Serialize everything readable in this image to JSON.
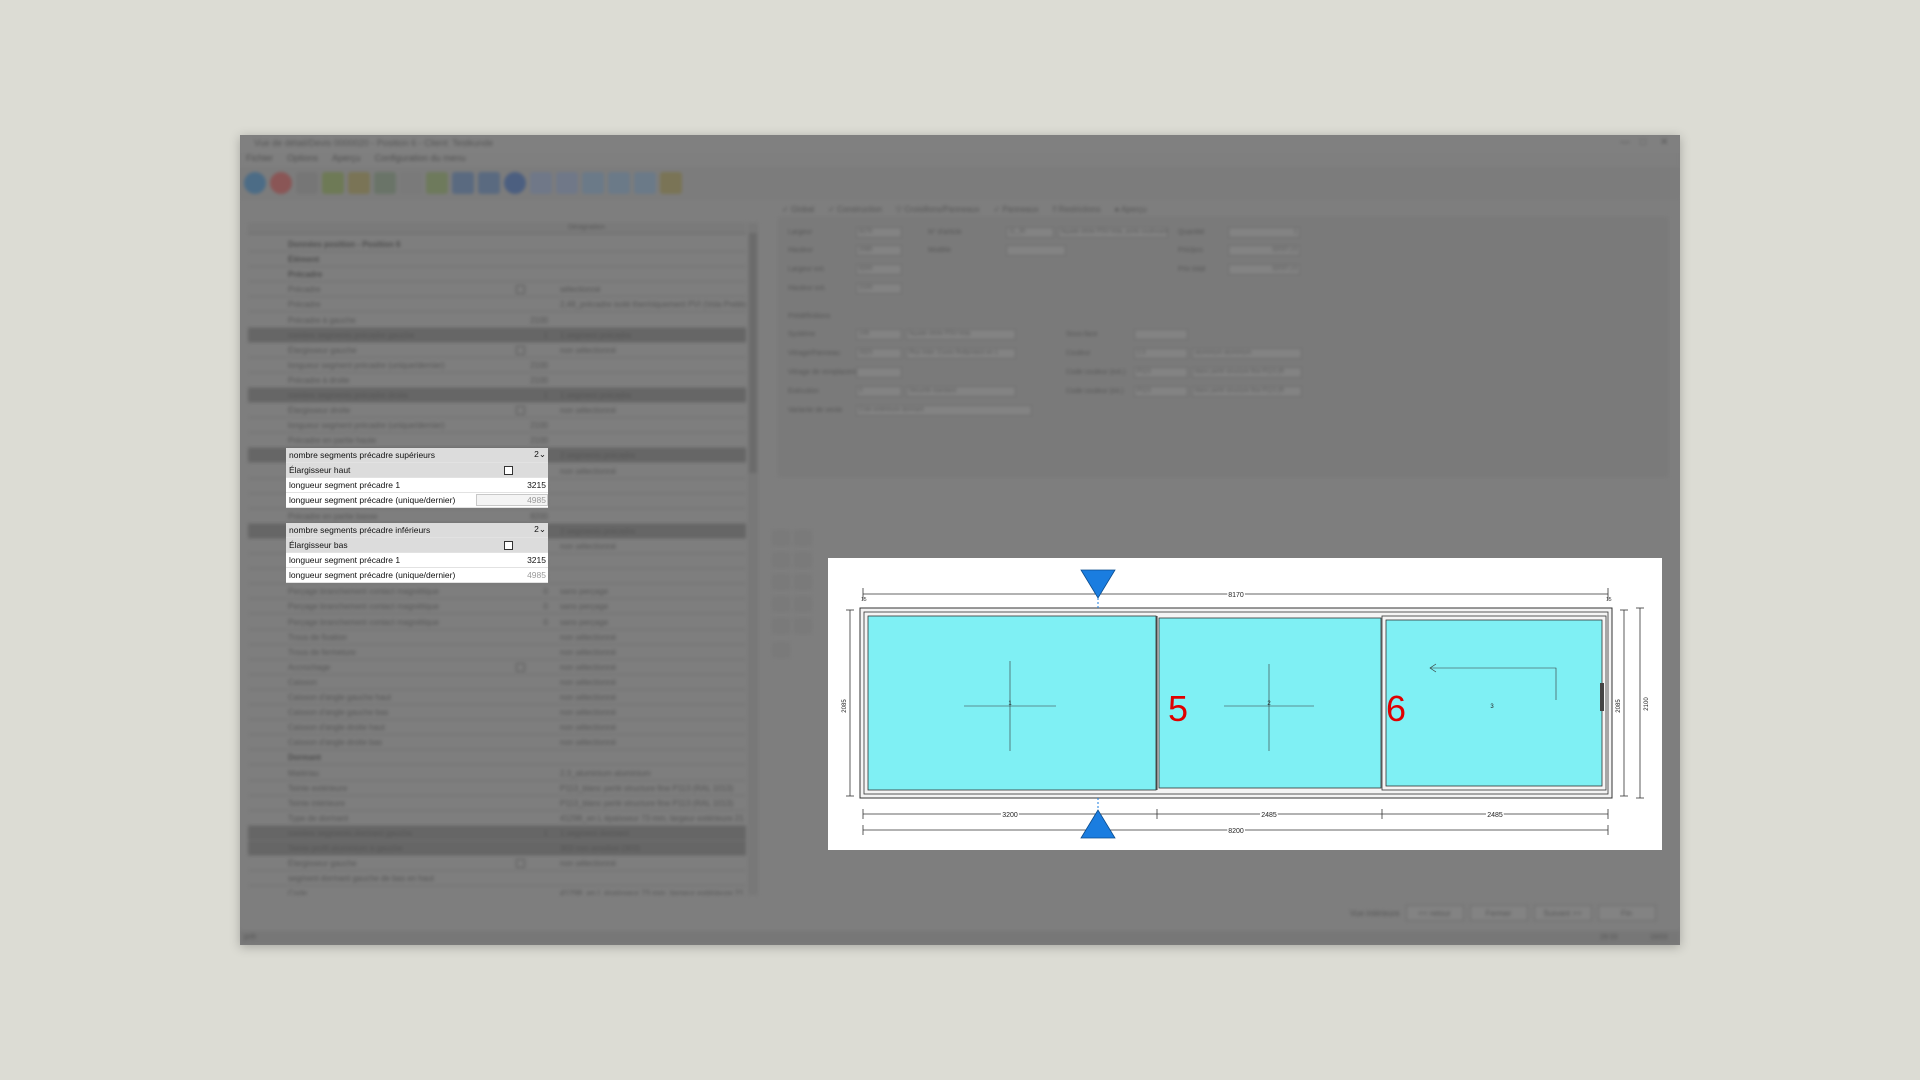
{
  "window": {
    "title": "Vue de détail/Devis 0000020 - Position 6 - Client: Testkunde",
    "menu": [
      "Fichier",
      "Options",
      "Aperçu",
      "Configuration du menu"
    ]
  },
  "grid": {
    "header": {
      "designation": "Désignation"
    },
    "rows": [
      {
        "label": "Données position - Position 6",
        "type": "sect"
      },
      {
        "label": "Élément",
        "type": "sect"
      },
      {
        "label": "Précadre",
        "type": "sect"
      },
      {
        "label": "Précadre",
        "value": "",
        "desc": "sélectionné",
        "check": true
      },
      {
        "label": "Précadre",
        "value": "",
        "desc": "2,48_précadre isolé thermiquement PVI (Vola Preblo)"
      },
      {
        "label": "Précadre à gauche",
        "value": "2100",
        "desc": ""
      },
      {
        "label": "nombre segments précadre gauche",
        "value": "1",
        "desc": "1 segment précadre",
        "type": "dark"
      },
      {
        "label": "Élargisseur gauche",
        "value": "",
        "desc": "non sélectionné",
        "check": true
      },
      {
        "label": "longueur segment précadre (unique/dernier)",
        "value": "2100",
        "desc": ""
      },
      {
        "label": "Précadre à droite",
        "value": "2100",
        "desc": ""
      },
      {
        "label": "nombre segments précadre droite",
        "value": "1",
        "desc": "1 segment précadre",
        "type": "dark"
      },
      {
        "label": "Élargisseur droite",
        "value": "",
        "desc": "non sélectionné",
        "check": true
      },
      {
        "label": "longueur segment précadre (unique/dernier)",
        "value": "2100",
        "desc": ""
      },
      {
        "label": "Précadre en partie haute",
        "value": "2100",
        "desc": ""
      },
      {
        "label": "nombre segments précadre supérieurs",
        "value": "2",
        "desc": "2 segments précadre",
        "type": "dark"
      },
      {
        "label": "Élargisseur haut",
        "value": "",
        "desc": "non sélectionné"
      },
      {
        "label": "longueur segment précadre 1",
        "value": "3215",
        "desc": ""
      },
      {
        "label": "longueur segment précadre (unique/dernier)",
        "value": "4985",
        "desc": ""
      },
      {
        "label": "Précadre en partie basse",
        "value": "8200",
        "desc": ""
      },
      {
        "label": "nombre segments précadre inférieurs",
        "value": "2",
        "desc": "2 segments précadre",
        "type": "dark"
      },
      {
        "label": "Élargisseur bas",
        "value": "",
        "desc": "non sélectionné"
      },
      {
        "label": "longueur segment précadre 1",
        "value": "3215",
        "desc": ""
      },
      {
        "label": "longueur segment précadre (unique/dernier)",
        "value": "4985",
        "desc": ""
      },
      {
        "label": "Perçage branchement contact magnétique",
        "value": "0",
        "desc": "sans perçage"
      },
      {
        "label": "Perçage branchement contact magnétique",
        "value": "0",
        "desc": "sans perçage"
      },
      {
        "label": "Perçage branchement contact magnétique",
        "value": "0",
        "desc": "sans perçage"
      },
      {
        "label": "Trous de fixation",
        "value": "",
        "desc": "non sélectionné"
      },
      {
        "label": "Trous de fermeture",
        "value": "",
        "desc": "non sélectionné"
      },
      {
        "label": "Accrochage",
        "value": "",
        "desc": "non sélectionné",
        "check": true
      },
      {
        "label": "Caisson",
        "value": "",
        "desc": "non sélectionné"
      },
      {
        "label": "Caisson d'angle gauche haut",
        "value": "",
        "desc": "non sélectionné"
      },
      {
        "label": "Caisson d'angle gauche bas",
        "value": "",
        "desc": "non sélectionné"
      },
      {
        "label": "Caisson d'angle droite haut",
        "value": "",
        "desc": "non sélectionné"
      },
      {
        "label": "Caisson d'angle droite bas",
        "value": "",
        "desc": "non sélectionné"
      },
      {
        "label": "Dormant",
        "type": "sect"
      },
      {
        "label": "Matériau",
        "value": "",
        "desc": "2.3_aluminium aluminium"
      },
      {
        "label": "Teinte extérieure",
        "value": "",
        "desc": "P113_blanc perlé structure fine P113 (RAL 1013)"
      },
      {
        "label": "Teinte intérieure",
        "value": "",
        "desc": "P113_blanc perlé structure fine P113 (RAL 1013)"
      },
      {
        "label": "Type de dormant",
        "value": "",
        "desc": "41298_en L épaisseur 73 mm, largeur extérieure 21 m"
      },
      {
        "label": "nombre segments dormant gauche",
        "value": "1",
        "desc": "1 segment dormant",
        "type": "dark"
      },
      {
        "label": "Teinte profil aluminium à gauche",
        "value": "",
        "desc": "303 non anodisé (303)",
        "type": "dark"
      },
      {
        "label": "Élargisseur gauche",
        "value": "",
        "desc": "non sélectionné",
        "check": true
      },
      {
        "label": "segment dormant gauche de bas en haut",
        "value": "",
        "desc": ""
      },
      {
        "label": "Code",
        "value": "",
        "desc": "41298_en L épaisseur 73 mm, largeur extérieure 21 m"
      }
    ]
  },
  "popup": {
    "top_group": {
      "count_label": "nombre segments précadre supérieurs",
      "count_value": "2",
      "widener_label": "Élargisseur haut",
      "seg1_label": "longueur segment précadre 1",
      "seg1_value": "3215",
      "last_label": "longueur segment précadre (unique/dernier)",
      "last_value": "4985"
    },
    "bottom_group": {
      "count_label": "nombre segments précadre inférieurs",
      "count_value": "2",
      "widener_label": "Élargisseur bas",
      "seg1_label": "longueur segment précadre 1",
      "seg1_value": "3215",
      "last_label": "longueur segment précadre (unique/dernier)",
      "last_value": "4985"
    }
  },
  "tabs": [
    "Global",
    "Construction",
    "Croisillons/Panneaux",
    "Panneaux",
    "Restrictions",
    "Aperçu"
  ],
  "form": {
    "largeur_label": "Largeur",
    "largeur_value": "8170",
    "hauteur_label": "Hauteur",
    "hauteur_value": "2085",
    "largeur_ext_label": "Largeur ext.",
    "largeur_ext_value": "8200",
    "hauteur_ext_label": "Hauteur ext.",
    "hauteur_ext_value": "2100",
    "article_label": "N° d'article",
    "article_value": "11_20",
    "article_desc": "façade vitrée PSV-Vola, porte coulissante",
    "modele_label": "Modèle",
    "quantite_label": "Quantité",
    "quantite_value": "1",
    "prix_unit_label": "Prix/pcs",
    "prix_unit_value": "32037,13",
    "prix_total_label": "Prix total",
    "prix_total_value": "32037,13",
    "predef_label": "Prédéfinitions",
    "systeme_label": "Système",
    "systeme_value": "109",
    "systeme_desc": "façade vitrée PSV-Vola",
    "vitrage_label": "Vitrage/Panneau",
    "vitrage_value": "3323",
    "vitrage_desc": "Plus Inter. Cuves Rollprotect en 1",
    "vitrage_remp_label": "Vitrage de remplacement",
    "execution_label": "Exécution",
    "execution_value": "0",
    "execution_desc": "Sécurité standard",
    "variante_label": "Variante de vente",
    "variante_value": "Cote extérieure dormant",
    "sous_face_label": "Sous-face",
    "couleur_label": "Couleur",
    "couleur_value": "2.3",
    "couleur_desc": "aluminium aluminium",
    "code_ext_label": "Code couleur (ext.)",
    "code_ext_value": "P113",
    "code_ext_desc": "blanc perlé structure fine P113 (R",
    "code_int_label": "Code couleur (int.)",
    "code_int_value": "P113",
    "code_int_desc": "blanc perlé structure fine P113 (R"
  },
  "bottom_buttons": {
    "view": "Vue intérieure",
    "back": "<< retour",
    "close": "Fermer",
    "next": "Suivant >>",
    "end": "Fin"
  },
  "status": {
    "left": "prêt",
    "right1": "28:33",
    "right2": "16/03"
  },
  "drawing": {
    "top_dim": "8170",
    "bottom_dim": "8200",
    "seg_dims": [
      "3200",
      "2485",
      "2485"
    ],
    "left_dim": "2085",
    "right_dim_inner": "2085",
    "right_dim_outer": "2100",
    "corner_label_left": "15",
    "corner_label_right": "15",
    "pane_numbers": [
      "1",
      "2",
      "3"
    ],
    "callouts": [
      "5",
      "6"
    ],
    "glass_color": "#7ff0f4",
    "callout_color": "#e00000",
    "marker_color": "#1a7de0"
  }
}
